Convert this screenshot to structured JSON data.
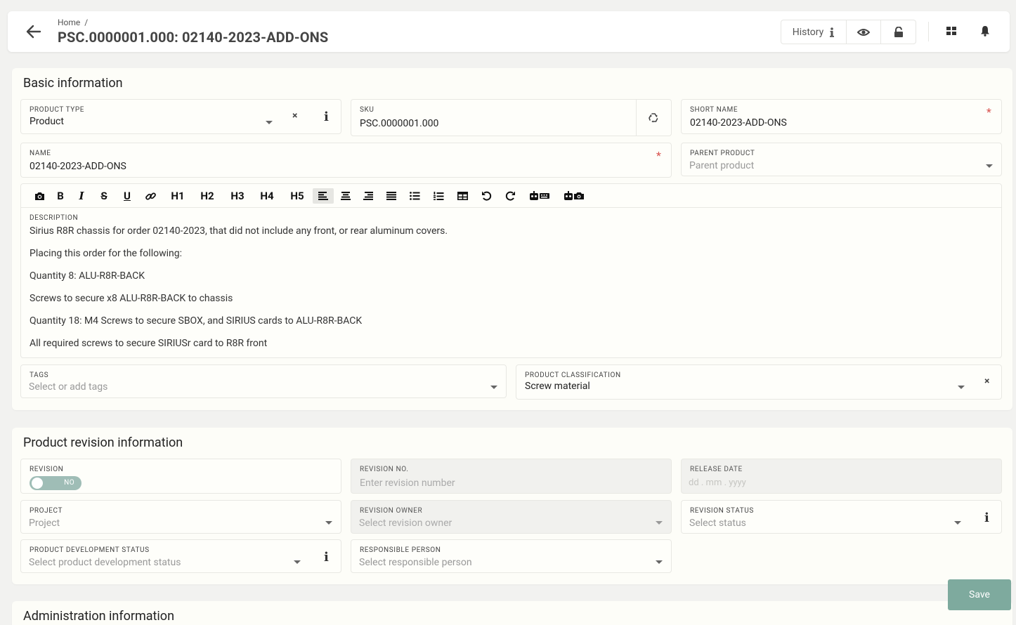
{
  "header": {
    "breadcrumb": "Home",
    "breadcrumb_sep": "/",
    "title": "PSC.0000001.000: 02140-2023-ADD-ONS",
    "history_label": "History",
    "icons": [
      "arrow-left-icon",
      "info-icon",
      "eye-icon",
      "unlock-icon",
      "grid-icon",
      "bell-icon"
    ]
  },
  "basic": {
    "title": "Basic information",
    "product_type": {
      "label": "PRODUCT TYPE",
      "value": "Product",
      "clear": "×"
    },
    "sku": {
      "label": "SKU",
      "value": "PSC.0000001.000"
    },
    "short_name": {
      "label": "SHORT NAME",
      "value": "02140-2023-ADD-ONS",
      "required": "*"
    },
    "name": {
      "label": "NAME",
      "value": "02140-2023-ADD-ONS",
      "required": "*"
    },
    "parent_product": {
      "label": "PARENT PRODUCT",
      "placeholder": "Parent product"
    },
    "toolbar": {
      "h1": "H1",
      "h2": "H2",
      "h3": "H3",
      "h4": "H4",
      "h5": "H5",
      "bold": "B",
      "italic": "I",
      "strike": "S",
      "underline": "U"
    },
    "description": {
      "label": "DESCRIPTION",
      "lines": [
        "Sirius R8R chassis for order 02140-2023, that did not include any front, or rear aluminum covers.",
        "Placing this order for the following:",
        "Quantity 8: ALU-R8R-BACK",
        "Screws to secure x8 ALU-R8R-BACK to chassis",
        "Quantity 18: M4 Screws to secure SBOX, and SIRIUS cards to ALU-R8R-BACK",
        "All required screws to secure SIRIUSr card to R8R front"
      ]
    },
    "tags": {
      "label": "TAGS",
      "placeholder": "Select or add tags"
    },
    "classification": {
      "label": "PRODUCT CLASSIFICATION",
      "value": "Screw material",
      "clear": "×"
    }
  },
  "revision": {
    "title": "Product revision information",
    "revision": {
      "label": "REVISION",
      "toggle": "NO"
    },
    "revision_no": {
      "label": "REVISION NO.",
      "placeholder": "Enter revision number"
    },
    "release_date": {
      "label": "RELEASE DATE",
      "placeholder": "dd . mm .  yyyy"
    },
    "project": {
      "label": "PROJECT",
      "placeholder": "Project"
    },
    "revision_owner": {
      "label": "REVISION OWNER",
      "placeholder": "Select revision owner"
    },
    "revision_status": {
      "label": "REVISION STATUS",
      "placeholder": "Select status"
    },
    "dev_status": {
      "label": "PRODUCT DEVELOPMENT STATUS",
      "placeholder": "Select product development status"
    },
    "responsible": {
      "label": "RESPONSIBLE PERSON",
      "placeholder": "Select responsible person"
    }
  },
  "admin": {
    "title": "Administration information"
  },
  "save_label": "Save"
}
